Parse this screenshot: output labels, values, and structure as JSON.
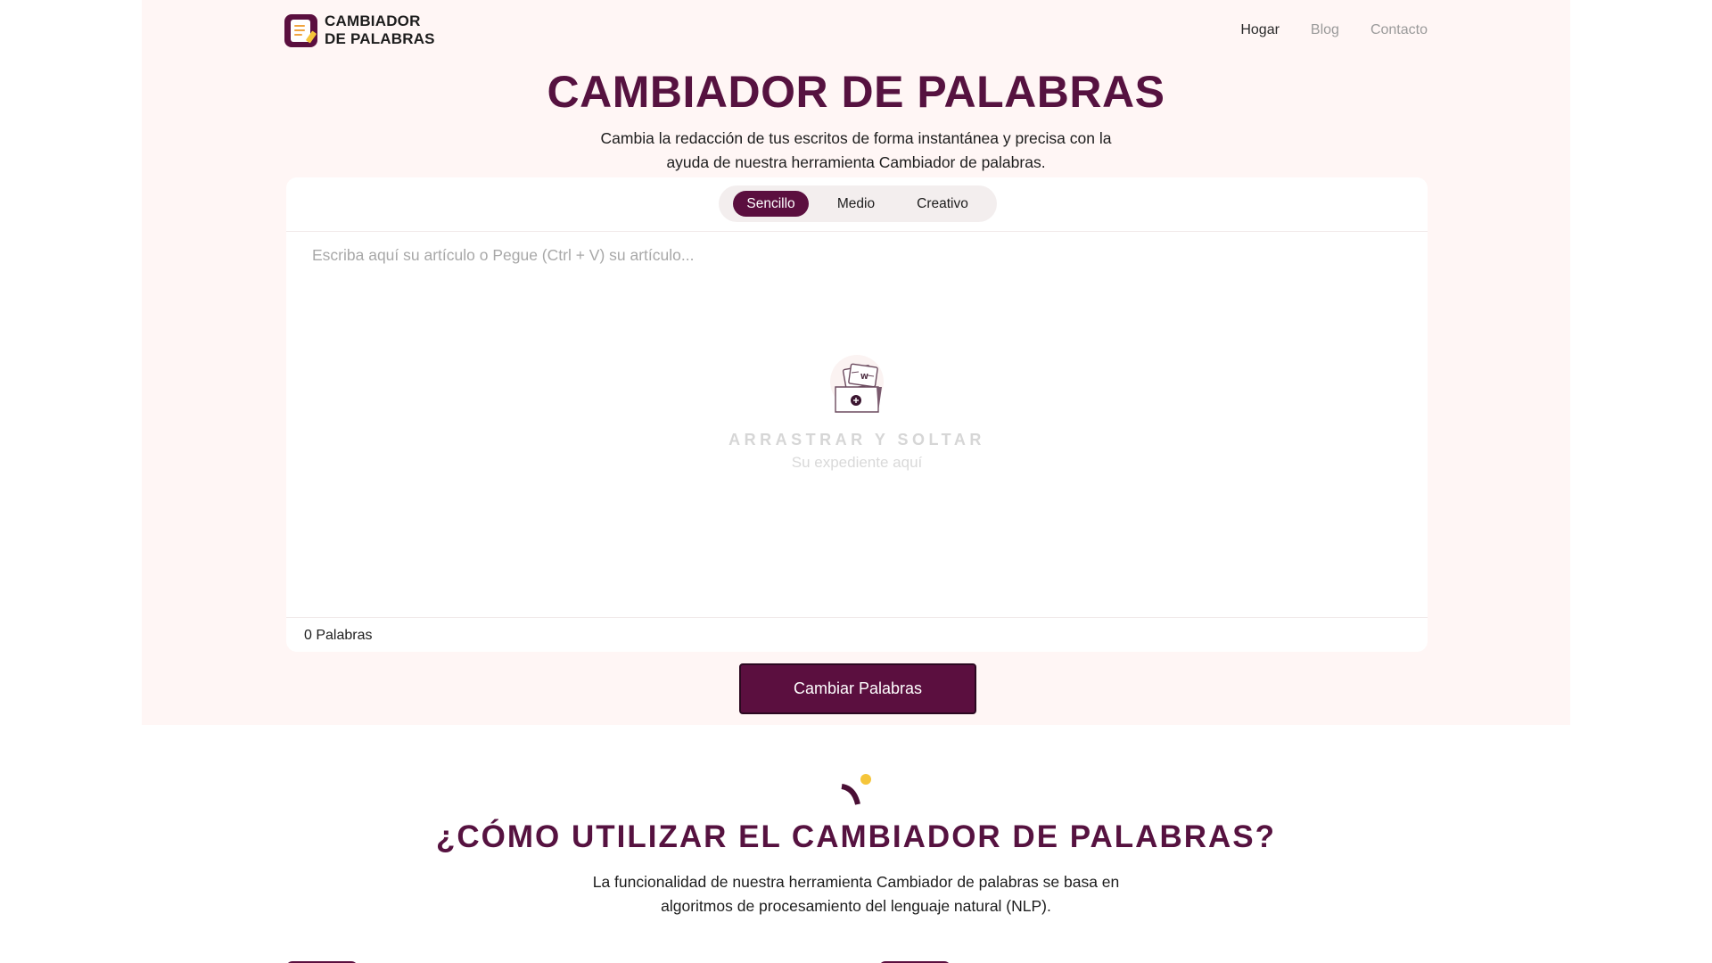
{
  "brand": {
    "name_line1": "CAMBIADOR",
    "name_line2": "DE PALABRAS"
  },
  "nav": {
    "items": [
      "Hogar",
      "Blog",
      "Contacto"
    ],
    "active": "Hogar"
  },
  "hero": {
    "title": "CAMBIADOR DE PALABRAS",
    "subtitle": "Cambia la redacción de tus escritos de forma instantánea y precisa con la ayuda de nuestra herramienta Cambiador de palabras."
  },
  "modes": {
    "options": [
      "Sencillo",
      "Medio",
      "Creativo"
    ],
    "selected": "Sencillo"
  },
  "editor": {
    "placeholder": "Escriba aquí su artículo o Pegue (Ctrl + V) su artículo...",
    "drop_title": "ARRASTRAR Y SOLTAR",
    "drop_subtitle": "Su expediente aquí",
    "word_count": "0 Palabras"
  },
  "submit": {
    "label": "Cambiar Palabras"
  },
  "how_to": {
    "title": "¿CÓMO UTILIZAR EL CAMBIADOR DE PALABRAS?",
    "text": "La funcionalidad de nuestra herramienta Cambiador de palabras se basa en algoritmos de procesamiento del lenguaje natural (NLP)."
  },
  "colors": {
    "brand": "#5b0f3f",
    "title": "#561240",
    "hero_background": "#fff6f5",
    "accent_yellow": "#f5c53a"
  },
  "icons": {
    "logo": "document-pen-icon",
    "drop": "file-upload-icon",
    "decoration": "arc-dot-icon"
  }
}
